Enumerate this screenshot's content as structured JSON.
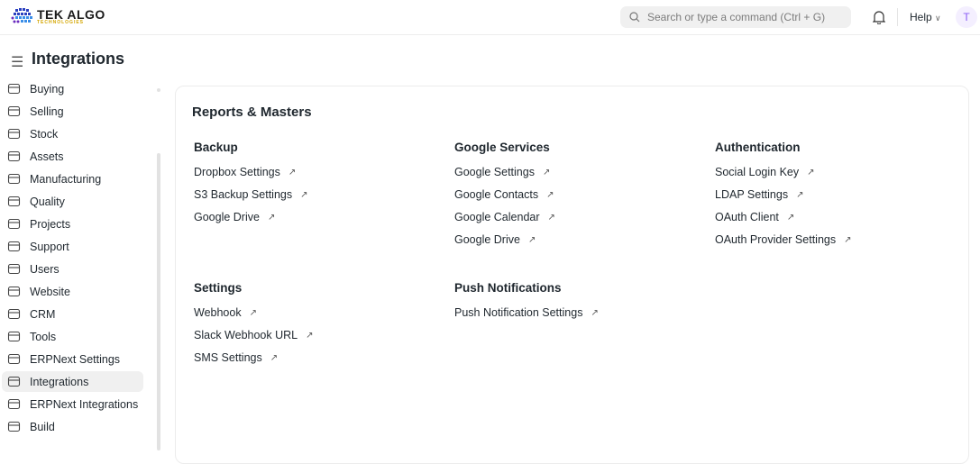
{
  "header": {
    "logo_main": "TEK ALGO",
    "logo_sub": "TECHNOLOGIES",
    "search_placeholder": "Search or type a command (Ctrl + G)",
    "help_label": "Help",
    "avatar_initial": "T"
  },
  "page": {
    "title": "Integrations"
  },
  "sidebar": {
    "items": [
      {
        "label": "Buying"
      },
      {
        "label": "Selling"
      },
      {
        "label": "Stock"
      },
      {
        "label": "Assets"
      },
      {
        "label": "Manufacturing"
      },
      {
        "label": "Quality"
      },
      {
        "label": "Projects"
      },
      {
        "label": "Support"
      },
      {
        "label": "Users"
      },
      {
        "label": "Website"
      },
      {
        "label": "CRM"
      },
      {
        "label": "Tools"
      },
      {
        "label": "ERPNext Settings"
      },
      {
        "label": "Integrations",
        "active": true
      },
      {
        "label": "ERPNext Integrations"
      },
      {
        "label": "Build"
      }
    ]
  },
  "main": {
    "title": "Reports & Masters",
    "sections": [
      {
        "title": "Backup",
        "links": [
          "Dropbox Settings",
          "S3 Backup Settings",
          "Google Drive"
        ]
      },
      {
        "title": "Google Services",
        "links": [
          "Google Settings",
          "Google Contacts",
          "Google Calendar",
          "Google Drive"
        ]
      },
      {
        "title": "Authentication",
        "links": [
          "Social Login Key",
          "LDAP Settings",
          "OAuth Client",
          "OAuth Provider Settings"
        ]
      },
      {
        "title": "Settings",
        "links": [
          "Webhook",
          "Slack Webhook URL",
          "SMS Settings"
        ]
      },
      {
        "title": "Push Notifications",
        "links": [
          "Push Notification Settings"
        ]
      }
    ],
    "arrow": "↗"
  }
}
